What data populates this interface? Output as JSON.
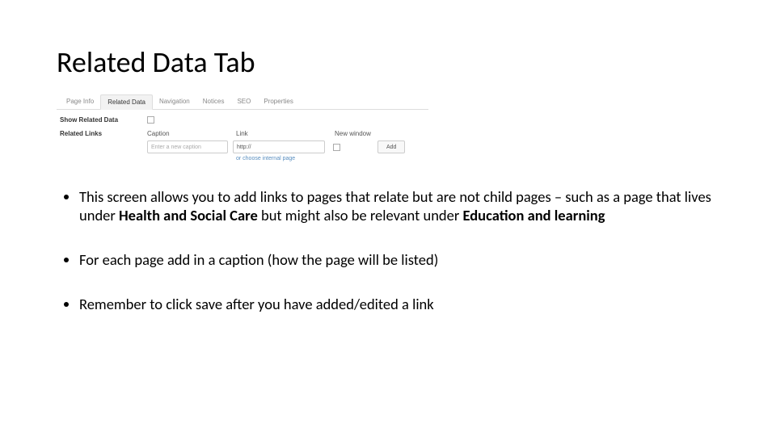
{
  "title": "Related Data Tab",
  "screenshot": {
    "tabs": [
      "Page Info",
      "Related Data",
      "Navigation",
      "Notices",
      "SEO",
      "Properties"
    ],
    "active_tab_index": 1,
    "show_related_label": "Show Related Data",
    "related_links_label": "Related Links",
    "columns": {
      "caption": "Caption",
      "link": "Link",
      "new_window": "New window"
    },
    "caption_placeholder": "Enter a new caption",
    "link_value": "http://",
    "add_button": "Add",
    "choose_internal": "or choose internal page"
  },
  "bullets": {
    "b1_a": "This screen allows you to add links to pages that relate but are not child pages – such as a page that lives under ",
    "b1_bold1": "Health and Social Care",
    "b1_b": " but might also be relevant under ",
    "b1_bold2": "Education and learning",
    "b2": "For each page add in a caption (how the page will be listed)",
    "b3": "Remember to click save after you have added/edited a link"
  }
}
